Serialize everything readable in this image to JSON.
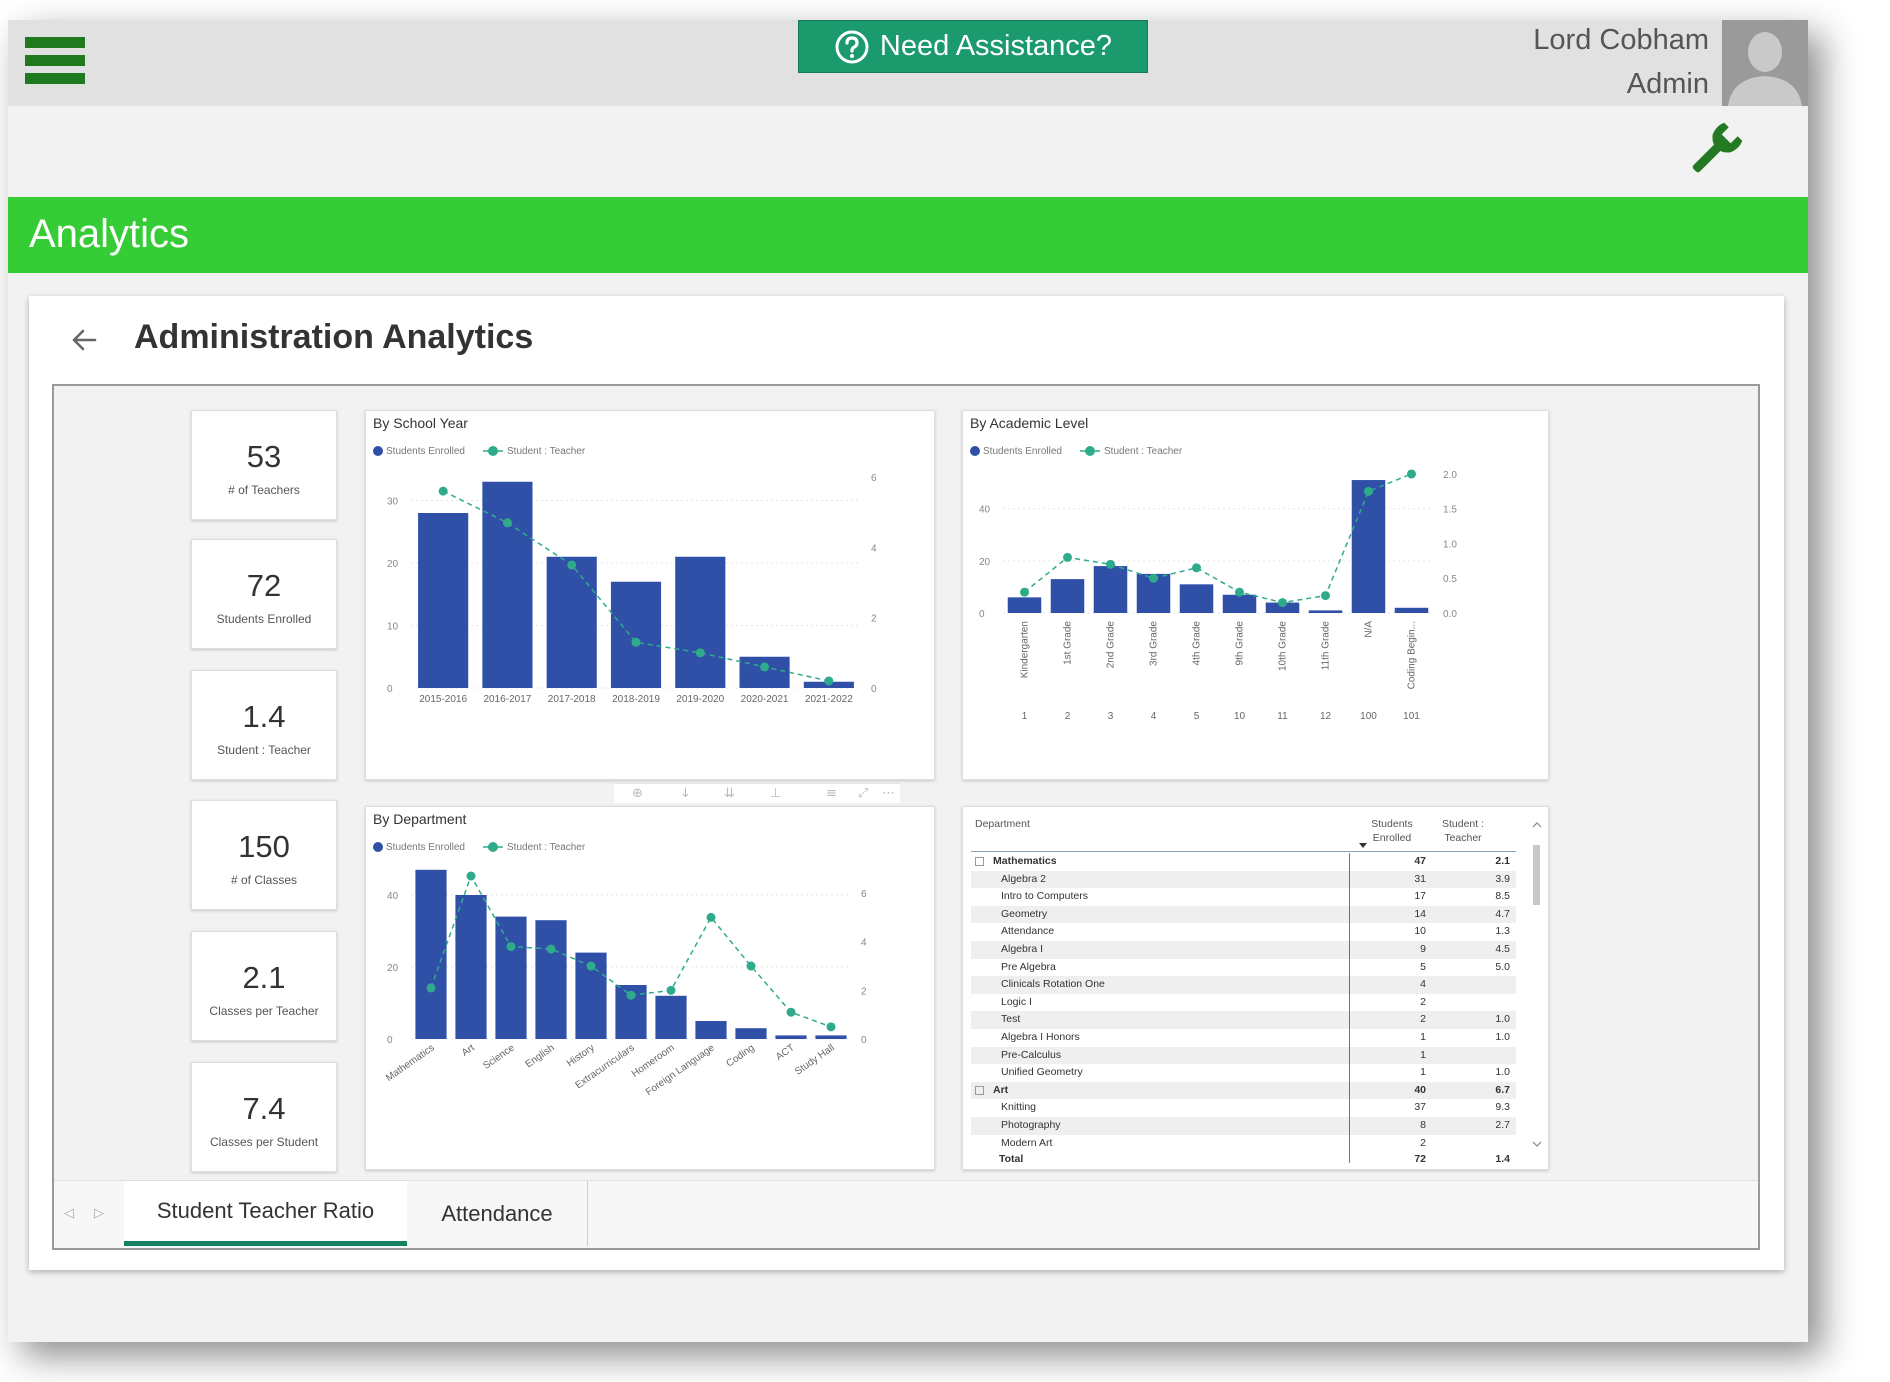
{
  "header": {
    "assist_label": "Need Assistance?",
    "user_name": "Lord Cobham",
    "user_role": "Admin"
  },
  "banner": {
    "title": "Analytics"
  },
  "page": {
    "title": "Administration Analytics"
  },
  "colors": {
    "bar": "#3050a8",
    "line": "#2fab8b",
    "banner": "#35cc35",
    "assist": "#1b9a6e",
    "tab_underline": "#168060"
  },
  "icons": {
    "menu": "hamburger-icon",
    "help": "question-circle-icon",
    "settings": "wrench-icon",
    "back": "arrow-left-icon",
    "avatar": "user-silhouette-icon"
  },
  "kpis": [
    {
      "value": "53",
      "label": "# of Teachers"
    },
    {
      "value": "72",
      "label": "Students Enrolled"
    },
    {
      "value": "1.4",
      "label": "Student : Teacher"
    },
    {
      "value": "150",
      "label": "# of Classes"
    },
    {
      "value": "2.1",
      "label": "Classes per Teacher"
    },
    {
      "value": "7.4",
      "label": "Classes per Student"
    }
  ],
  "chart_data": [
    {
      "type": "bar",
      "title": "By School Year",
      "legend": [
        "Students Enrolled",
        "Student : Teacher"
      ],
      "legend_position": "top-left",
      "categories": [
        "2015-2016",
        "2016-2017",
        "2017-2018",
        "2018-2019",
        "2019-2020",
        "2020-2021",
        "2021-2022"
      ],
      "series": [
        {
          "name": "Students Enrolled",
          "type": "bar",
          "axis": "left",
          "values": [
            28,
            33,
            21,
            17,
            21,
            5,
            1
          ]
        },
        {
          "name": "Student : Teacher",
          "type": "line",
          "axis": "right",
          "values": [
            5.6,
            4.7,
            3.5,
            1.3,
            1.0,
            0.6,
            0.2
          ]
        }
      ],
      "ylim": [
        0,
        36
      ],
      "yticks": [
        0,
        10,
        20,
        30
      ],
      "y2lim": [
        0,
        6.4
      ],
      "y2ticks": [
        0,
        2,
        4,
        6
      ],
      "grid": true
    },
    {
      "type": "bar",
      "title": "By Academic Level",
      "legend": [
        "Students Enrolled",
        "Student : Teacher"
      ],
      "legend_position": "top-left",
      "categories": [
        "Kindergarten",
        "1st Grade",
        "2nd Grade",
        "3rd Grade",
        "4th Grade",
        "9th Grade",
        "10th Grade",
        "11th Grade",
        "N/A",
        "Coding Begin..."
      ],
      "category_codes": [
        "1",
        "2",
        "3",
        "4",
        "5",
        "10",
        "11",
        "12",
        "100",
        "101"
      ],
      "series": [
        {
          "name": "Students Enrolled",
          "type": "bar",
          "axis": "left",
          "values": [
            6,
            13,
            18,
            15,
            11,
            7,
            4,
            1,
            51,
            2
          ]
        },
        {
          "name": "Student : Teacher",
          "type": "line",
          "axis": "right",
          "values": [
            0.3,
            0.8,
            0.7,
            0.5,
            0.65,
            0.3,
            0.15,
            0.25,
            1.75,
            2.0
          ]
        }
      ],
      "ylim": [
        0,
        56
      ],
      "yticks": [
        0,
        20,
        40
      ],
      "y2lim": [
        0,
        2.1
      ],
      "y2ticks": [
        "0.0",
        "0.5",
        "1.0",
        "1.5",
        "2.0"
      ],
      "grid": true
    },
    {
      "type": "bar",
      "title": "By Department",
      "legend": [
        "Students Enrolled",
        "Student : Teacher"
      ],
      "legend_position": "top-left",
      "categories": [
        "Mathematics",
        "Art",
        "Science",
        "English",
        "History",
        "Extracurriculars",
        "Homeroom",
        "Foreign Language",
        "Coding",
        "ACT",
        "Study Hall"
      ],
      "series": [
        {
          "name": "Students Enrolled",
          "type": "bar",
          "axis": "left",
          "values": [
            47,
            40,
            34,
            33,
            24,
            15,
            12,
            5,
            3,
            1,
            1
          ]
        },
        {
          "name": "Student : Teacher",
          "type": "line",
          "axis": "right",
          "values": [
            2.1,
            6.7,
            3.8,
            3.7,
            3.0,
            1.8,
            2.0,
            5.0,
            3.0,
            1.1,
            0.5
          ]
        }
      ],
      "ylim": [
        0,
        50
      ],
      "yticks": [
        0,
        20,
        40
      ],
      "y2lim": [
        0,
        7.4
      ],
      "y2ticks": [
        0,
        2,
        4,
        6
      ],
      "grid": true
    }
  ],
  "matrix": {
    "headers": {
      "department": "Department",
      "enrolled": "Students Enrolled",
      "ratio": "Student : Teacher"
    },
    "rows": [
      {
        "name": "Mathematics",
        "enrolled": "47",
        "ratio": "2.1",
        "level": 0
      },
      {
        "name": "Algebra 2",
        "enrolled": "31",
        "ratio": "3.9",
        "level": 1
      },
      {
        "name": "Intro to Computers",
        "enrolled": "17",
        "ratio": "8.5",
        "level": 1
      },
      {
        "name": "Geometry",
        "enrolled": "14",
        "ratio": "4.7",
        "level": 1
      },
      {
        "name": "Attendance",
        "enrolled": "10",
        "ratio": "1.3",
        "level": 1
      },
      {
        "name": "Algebra I",
        "enrolled": "9",
        "ratio": "4.5",
        "level": 1
      },
      {
        "name": "Pre Algebra",
        "enrolled": "5",
        "ratio": "5.0",
        "level": 1
      },
      {
        "name": "Clinicals Rotation One",
        "enrolled": "4",
        "ratio": "",
        "level": 1
      },
      {
        "name": "Logic I",
        "enrolled": "2",
        "ratio": "",
        "level": 1
      },
      {
        "name": "Test",
        "enrolled": "2",
        "ratio": "1.0",
        "level": 1
      },
      {
        "name": "Algebra I Honors",
        "enrolled": "1",
        "ratio": "1.0",
        "level": 1
      },
      {
        "name": "Pre-Calculus",
        "enrolled": "1",
        "ratio": "",
        "level": 1
      },
      {
        "name": "Unified Geometry",
        "enrolled": "1",
        "ratio": "1.0",
        "level": 1
      },
      {
        "name": "Art",
        "enrolled": "40",
        "ratio": "6.7",
        "level": 0
      },
      {
        "name": "Knitting",
        "enrolled": "37",
        "ratio": "9.3",
        "level": 1
      },
      {
        "name": "Photography",
        "enrolled": "8",
        "ratio": "2.7",
        "level": 1
      },
      {
        "name": "Modern Art",
        "enrolled": "2",
        "ratio": "",
        "level": 1
      }
    ],
    "total": {
      "label": "Total",
      "enrolled": "72",
      "ratio": "1.4"
    }
  },
  "tabs": [
    {
      "label": "Student Teacher Ratio",
      "active": true
    },
    {
      "label": "Attendance",
      "active": false
    }
  ]
}
